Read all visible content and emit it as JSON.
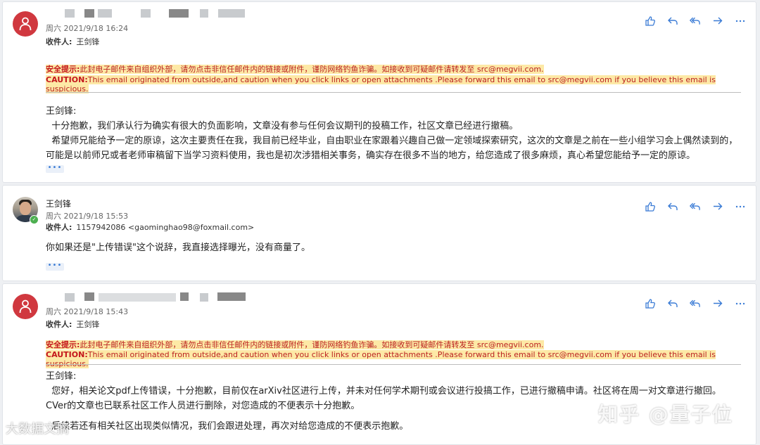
{
  "messages": [
    {
      "sender": "",
      "date": "周六 2021/9/18 16:24",
      "recipient_label": "收件人:",
      "recipient": "王剑锋",
      "warning_cn_key": "安全提示:",
      "warning_cn": "此封电子邮件来自组织外部，请勿点击非信任邮件内的链接或附件，谨防网络钓鱼诈骗。如接收到可疑邮件请转发至 src@megvii.com.",
      "warning_en_key": "CAUTION:",
      "warning_en": "This email originated from outside,and caution when you click links or open attachments .Please forward this email to src@megvii.com if you believe this email is suspicious.",
      "body": [
        "王剑锋:",
        "  十分抱歉，我们承认行为确实有很大的负面影响，文章没有参与任何会议期刊的投稿工作，社区文章已经进行撤稿。",
        "  希望师兄能给予一定的原谅，这次主要责任在我，我目前已经毕业，自由职业在家跟着兴趣自己做一定领域探索研究，这次的文章是之前在一些小组学习会上偶然读到的，可能是以前师兄或者老师审稿留下当学习资料使用，我也是初次涉猎相关事务，确实存在很多不当的地方，给您造成了很多麻烦，真心希望您能给予一定的原谅。"
      ]
    },
    {
      "sender": "王剑锋",
      "date": "周六 2021/9/18 15:53",
      "recipient_label": "收件人:",
      "recipient": "1157942086 <gaominghao98@foxmail.com>",
      "body": [
        "你如果还是\"上传错误\"这个说辞，我直接选择曝光，没有商量了。"
      ]
    },
    {
      "sender": "",
      "date": "周六 2021/9/18 15:43",
      "recipient_label": "收件人:",
      "recipient": "王剑锋",
      "warning_cn_key": "安全提示:",
      "warning_cn": "此封电子邮件来自组织外部，请勿点击非信任邮件内的链接或附件，谨防网络钓鱼诈骗。如接收到可疑邮件请转发至 src@megvii.com.",
      "warning_en_key": "CAUTION:",
      "warning_en": "This email originated from outside,and caution when you click links or open attachments .Please forward this email to src@megvii.com if you believe this email is suspicious.",
      "body": [
        "王剑锋:",
        "  您好，相关论文pdf上传错误，十分抱歉，目前仅在arXiv社区进行上传，并未对任何学术期刊或会议进行投搞工作，已进行撤稿申请。社区将在周一对文章进行撤回。",
        "CVer的文章也已联系社区工作人员进行删除，对您造成的不便表示十分抱歉。",
        "",
        "  后续若还有相关社区出现类似情况，我们会跟进处理，再次对给您造成的不便表示抱歉。"
      ]
    }
  ],
  "more_label": "•••",
  "watermark_zhihu": "知乎 @量子位",
  "watermark_left": "大数据文摘",
  "colors": {
    "accent": "#3a7bd5",
    "avatar_red": "#d0383f",
    "warning_highlight": "#fde9a6",
    "caution_red": "#c4161c"
  }
}
